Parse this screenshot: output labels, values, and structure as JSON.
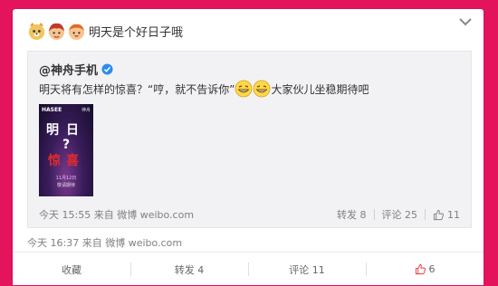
{
  "post": {
    "text": "明天是个好日子哦",
    "emoji_icons": [
      "doge-emoji-icon",
      "girl-emoji-icon",
      "boy-emoji-icon"
    ],
    "meta": {
      "time": "今天 16:37",
      "from_label": "来自",
      "source": "微博 weibo.com"
    }
  },
  "repost": {
    "author": "@神舟手机",
    "verified": true,
    "text_before": "明天将有怎样的惊喜？“哼，就不告诉你”",
    "text_after": " 大家伙儿坐稳期待吧",
    "poster": {
      "logo": "HASEE",
      "brand": "神舟",
      "line1": "明日",
      "q": "?",
      "line2": "惊喜",
      "date": "11月12日",
      "caption": "敬请期待"
    },
    "meta": {
      "time": "今天 15:55",
      "from_label": "来自",
      "source": "微博 weibo.com"
    },
    "actions": {
      "repost": "转发 8",
      "comment": "评论 25",
      "like": "11"
    }
  },
  "action_bar": {
    "favorite": "收藏",
    "repost": "转发 4",
    "comment": "评论 11",
    "like": "6"
  },
  "colors": {
    "background": "#e4145c",
    "link": "#333333",
    "muted": "#808080"
  }
}
